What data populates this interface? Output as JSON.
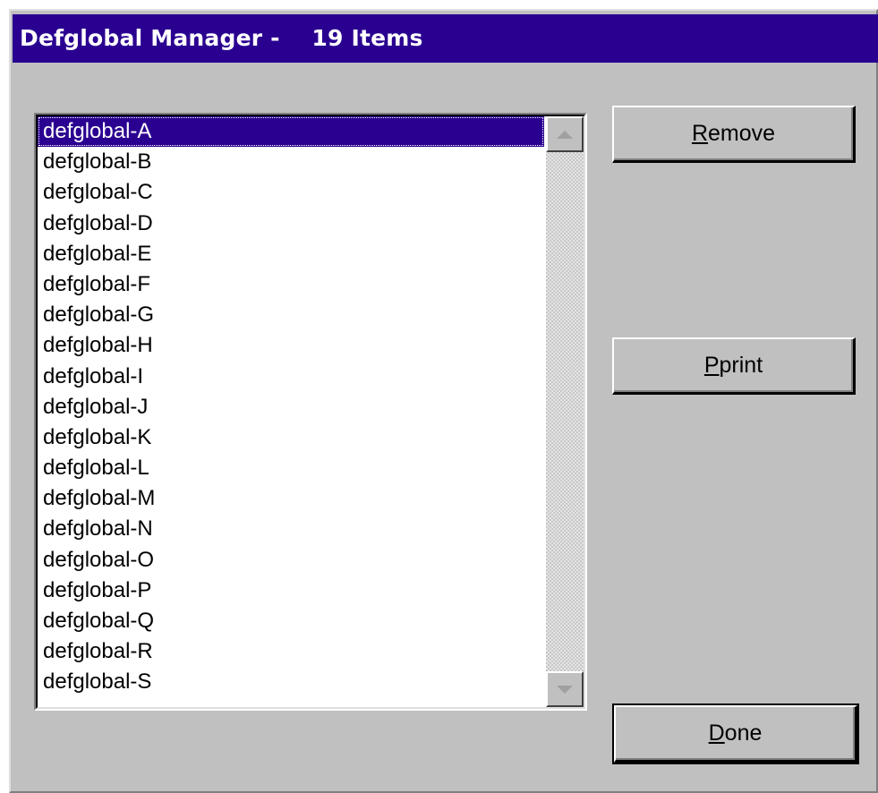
{
  "window": {
    "title": "Defglobal Manager -    19 Items"
  },
  "list": {
    "selected_index": 0,
    "items": [
      "defglobal-A",
      "defglobal-B",
      "defglobal-C",
      "defglobal-D",
      "defglobal-E",
      "defglobal-F",
      "defglobal-G",
      "defglobal-H",
      "defglobal-I",
      "defglobal-J",
      "defglobal-K",
      "defglobal-L",
      "defglobal-M",
      "defglobal-N",
      "defglobal-O",
      "defglobal-P",
      "defglobal-Q",
      "defglobal-R",
      "defglobal-S"
    ]
  },
  "buttons": {
    "remove": {
      "mnemonic": "R",
      "rest": "emove"
    },
    "print": {
      "mnemonic": "P",
      "rest": "print"
    },
    "done": {
      "mnemonic": "D",
      "rest": "one"
    }
  },
  "icons": {
    "scroll_up": "scroll-up-arrow-icon",
    "scroll_down": "scroll-down-arrow-icon"
  },
  "colors": {
    "titlebar": "#2a0090",
    "selection": "#2a0090",
    "face": "#c0c0c0"
  }
}
